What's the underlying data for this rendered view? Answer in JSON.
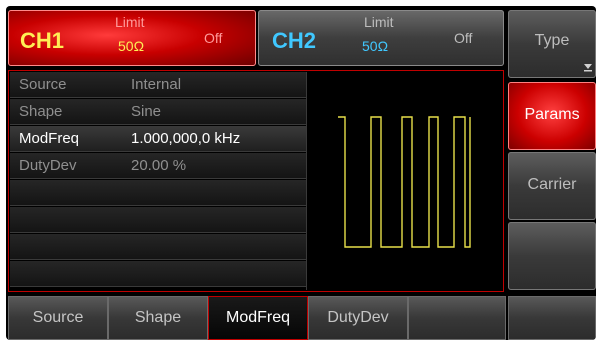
{
  "ch1": {
    "name": "CH1",
    "limit_label": "Limit",
    "impedance": "50Ω",
    "state": "Off"
  },
  "ch2": {
    "name": "CH2",
    "limit_label": "Limit",
    "impedance": "50Ω",
    "state": "Off"
  },
  "params": [
    {
      "label": "Source",
      "value": "Internal"
    },
    {
      "label": "Shape",
      "value": "Sine"
    },
    {
      "label": "ModFreq",
      "value": "1.000,000,0 kHz",
      "selected": true
    },
    {
      "label": "DutyDev",
      "value": "20.00 %"
    }
  ],
  "side_menu": [
    {
      "label": "Type",
      "icon": "arrow-down-icon"
    },
    {
      "label": "Params",
      "active": true
    },
    {
      "label": "Carrier"
    },
    {
      "label": ""
    }
  ],
  "soft_keys": [
    {
      "label": "Source"
    },
    {
      "label": "Shape"
    },
    {
      "label": "ModFreq",
      "active": true
    },
    {
      "label": "DutyDev"
    },
    {
      "label": ""
    },
    {
      "label": ""
    }
  ],
  "colors": {
    "accent": "#cc0000",
    "ch1_text": "#ffee55",
    "ch2_text": "#40c8ff",
    "waveform": "#e8e04a"
  }
}
